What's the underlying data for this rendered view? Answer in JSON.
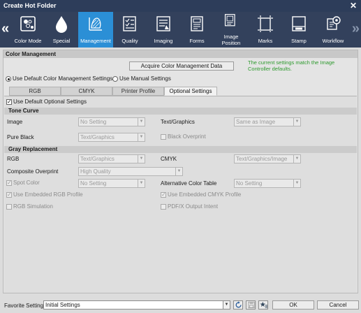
{
  "window": {
    "title": "Create Hot Folder"
  },
  "toolbar": {
    "items": [
      {
        "label": "Color Mode",
        "icon": "color-mode-icon"
      },
      {
        "label": "Special",
        "icon": "droplet-icon"
      },
      {
        "label": "Management",
        "icon": "color-management-icon",
        "active": true
      },
      {
        "label": "Quality",
        "icon": "quality-checklist-icon"
      },
      {
        "label": "Imaging",
        "icon": "imaging-icon"
      },
      {
        "label": "Forms",
        "icon": "forms-icon"
      },
      {
        "label": "Image\nPosition",
        "icon": "image-position-icon"
      },
      {
        "label": "Marks",
        "icon": "marks-icon"
      },
      {
        "label": "Stamp",
        "icon": "stamp-icon"
      },
      {
        "label": "Workflow",
        "icon": "workflow-icon"
      }
    ]
  },
  "colors": {
    "accent": "#2b8fd6",
    "titlebar": "#2d3d5a",
    "toolbar": "#33415c",
    "info_text": "#2e9a2e"
  },
  "color_management": {
    "header": "Color Management",
    "acquire_button": "Acquire Color Management Data",
    "info_text": "The current settings match the Image Controller defaults.",
    "radio_default": "Use Default Color Management Settings",
    "radio_manual": "Use Manual Settings",
    "tabs": [
      "RGB",
      "CMYK",
      "Printer Profile",
      "Optional Settings"
    ],
    "active_tab": "Optional Settings",
    "use_default_optional": "Use Default Optional Settings",
    "tone_curve": {
      "header": "Tone Curve",
      "image_label": "Image",
      "image_value": "No Setting",
      "text_graphics_label": "Text/Graphics",
      "text_graphics_value": "Same as Image",
      "pure_black_label": "Pure Black",
      "pure_black_value": "Text/Graphics",
      "black_overprint_label": "Black Overprint"
    },
    "gray_replacement": {
      "header": "Gray Replacement",
      "rgb_label": "RGB",
      "rgb_value": "Text/Graphics",
      "cmyk_label": "CMYK",
      "cmyk_value": "Text/Graphics/Image"
    },
    "composite_overprint_label": "Composite Overprint",
    "composite_overprint_value": "High Quality",
    "spot_color_label": "Spot Color",
    "spot_color_value": "No Setting",
    "alt_color_table_label": "Alternative Color Table",
    "alt_color_table_value": "No Setting",
    "use_embedded_rgb": "Use Embedded RGB Profile",
    "use_embedded_cmyk": "Use Embedded CMYK Profile",
    "rgb_simulation": "RGB Simulation",
    "pdfx_output_intent": "PDF/X Output Intent"
  },
  "footer": {
    "favorite_label": "Favorite Setting",
    "favorite_value": "Initial Settings",
    "ok": "OK",
    "cancel": "Cancel"
  }
}
